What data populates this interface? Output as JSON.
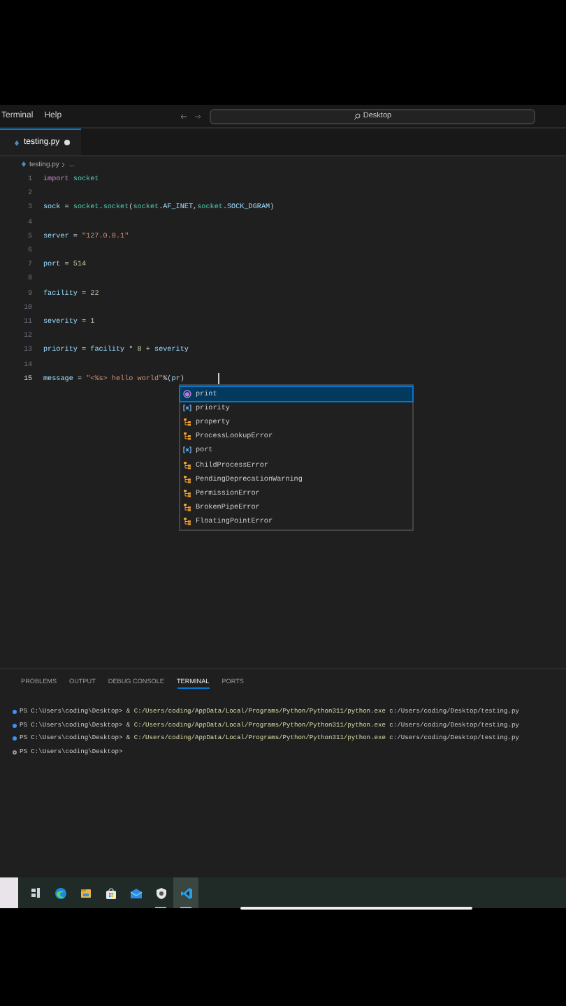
{
  "menu": [
    "Terminal",
    "Help"
  ],
  "command_center": {
    "label": "Desktop"
  },
  "tabs": [
    {
      "label": "testing.py",
      "selected": true,
      "modified": true
    }
  ],
  "breadcrumb": [
    "testing.py",
    "..."
  ],
  "code_lines": [
    {
      "number": "1",
      "current": false,
      "tokens": [
        {
          "kind": "keyword",
          "text": "import"
        },
        {
          "kind": "module",
          "text": "socket"
        }
      ]
    },
    {
      "number": "2",
      "current": false
    },
    {
      "number": "3",
      "current": false,
      "tokens": [
        {
          "kind": "variable",
          "text": "sock"
        },
        {
          "kind": "plain",
          "text": " = "
        },
        {
          "kind": "module",
          "text": "socket"
        },
        {
          "kind": "plain",
          "text": "."
        },
        {
          "kind": "module",
          "text": "socket"
        },
        {
          "kind": "plain",
          "text": "("
        },
        {
          "kind": "module",
          "text": "socket"
        },
        {
          "kind": "plain",
          "text": "."
        },
        {
          "kind": "variable",
          "text": "AF_INET"
        },
        {
          "kind": "plain",
          "text": ","
        },
        {
          "kind": "module",
          "text": "socket"
        },
        {
          "kind": "plain",
          "text": "."
        },
        {
          "kind": "variable",
          "text": "SOCK_DGRAM"
        },
        {
          "kind": "plain",
          "text": ")"
        }
      ]
    },
    {
      "number": "4",
      "current": false
    },
    {
      "number": "5",
      "current": false,
      "tokens": [
        {
          "kind": "variable",
          "text": "server"
        },
        {
          "kind": "plain",
          "text": " = "
        },
        {
          "kind": "string",
          "text": "\"127.0.0.1\""
        }
      ]
    },
    {
      "number": "6",
      "current": false
    },
    {
      "number": "7",
      "current": false,
      "tokens": [
        {
          "kind": "variable",
          "text": "port"
        },
        {
          "kind": "plain",
          "text": " = "
        },
        {
          "kind": "number",
          "text": "514"
        }
      ]
    },
    {
      "number": "8",
      "current": false
    },
    {
      "number": "9",
      "current": false,
      "tokens": [
        {
          "kind": "variable",
          "text": "facility"
        },
        {
          "kind": "plain",
          "text": " = "
        },
        {
          "kind": "number",
          "text": "22"
        }
      ]
    },
    {
      "number": "10",
      "current": false
    },
    {
      "number": "11",
      "current": false,
      "tokens": [
        {
          "kind": "variable",
          "text": "severity"
        },
        {
          "kind": "plain",
          "text": " = "
        },
        {
          "kind": "number",
          "text": "1"
        }
      ]
    },
    {
      "number": "12",
      "current": false
    },
    {
      "number": "13",
      "current": false,
      "tokens": [
        {
          "kind": "variable",
          "text": "priority"
        },
        {
          "kind": "plain",
          "text": " = "
        },
        {
          "kind": "variable",
          "text": "facility"
        },
        {
          "kind": "plain",
          "text": " * "
        },
        {
          "kind": "number",
          "text": "8"
        },
        {
          "kind": "plain",
          "text": " + "
        },
        {
          "kind": "variable",
          "text": "severity"
        }
      ]
    },
    {
      "number": "14",
      "current": false
    },
    {
      "number": "15",
      "current": true,
      "tokens": [
        {
          "kind": "variable",
          "text": "message"
        },
        {
          "kind": "plain",
          "text": " = "
        },
        {
          "kind": "string",
          "text": "\"<%s> hello world\""
        },
        {
          "kind": "plain",
          "text": "%("
        },
        {
          "kind": "variable",
          "text": "pr"
        },
        {
          "kind": "plain",
          "text": ")"
        }
      ]
    }
  ],
  "suggestions": [
    {
      "label": "print",
      "kind": "function",
      "selected": true
    },
    {
      "label": "priority",
      "kind": "variable",
      "selected": false
    },
    {
      "label": "property",
      "kind": "class",
      "selected": false
    },
    {
      "label": "ProcessLookupError",
      "kind": "class",
      "selected": false
    },
    {
      "label": "port",
      "kind": "variable",
      "selected": false
    },
    {
      "label": "ChildProcessError",
      "kind": "class",
      "selected": false
    },
    {
      "label": "PendingDeprecationWarning",
      "kind": "class",
      "selected": false
    },
    {
      "label": "PermissionError",
      "kind": "class",
      "selected": false
    },
    {
      "label": "BrokenPipeError",
      "kind": "class",
      "selected": false
    },
    {
      "label": "FloatingPointError",
      "kind": "class",
      "selected": false
    }
  ],
  "panel_tabs": [
    {
      "label": "PROBLEMS",
      "selected": false
    },
    {
      "label": "OUTPUT",
      "selected": false
    },
    {
      "label": "DEBUG CONSOLE",
      "selected": false
    },
    {
      "label": "TERMINAL",
      "selected": true
    },
    {
      "label": "PORTS",
      "selected": false
    }
  ],
  "terminal_lines": [
    {
      "completed": true,
      "prompt": "PS C:\\Users\\coding\\Desktop> & ",
      "command": "C:/Users/coding/AppData/Local/Programs/Python/Python311/python.exe",
      "args": " c:/Users/coding/Desktop/testing.py"
    },
    {
      "completed": true,
      "prompt": "PS C:\\Users\\coding\\Desktop> & ",
      "command": "C:/Users/coding/AppData/Local/Programs/Python/Python311/python.exe",
      "args": " c:/Users/coding/Desktop/testing.py"
    },
    {
      "completed": true,
      "prompt": "PS C:\\Users\\coding\\Desktop> & ",
      "command": "C:/Users/coding/AppData/Local/Programs/Python/Python311/python.exe",
      "args": " c:/Users/coding/Desktop/testing.py"
    },
    {
      "completed": false,
      "prompt": "PS C:\\Users\\coding\\Desktop>"
    }
  ],
  "taskbar": [
    {
      "kind": "task-view",
      "running": false
    },
    {
      "kind": "browser",
      "running": false
    },
    {
      "kind": "folder",
      "running": false
    },
    {
      "kind": "store",
      "running": false
    },
    {
      "kind": "mail",
      "running": false
    },
    {
      "kind": "shield",
      "running": true
    },
    {
      "kind": "code",
      "running": true
    }
  ]
}
